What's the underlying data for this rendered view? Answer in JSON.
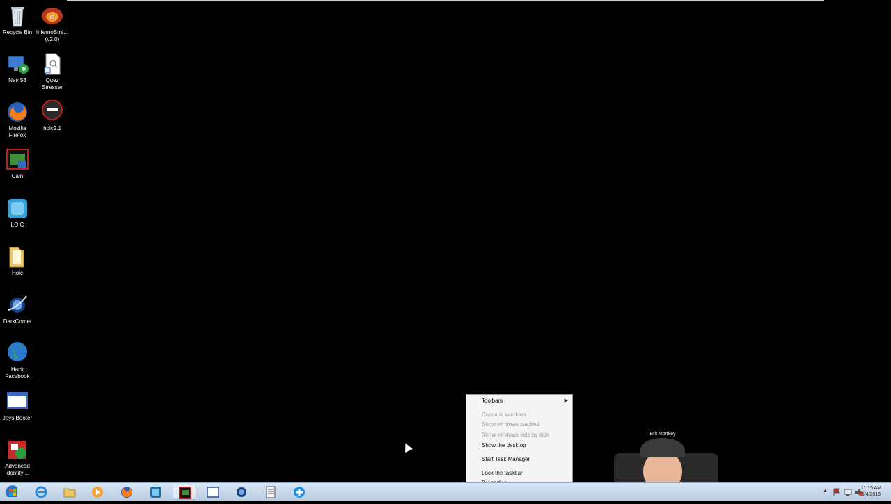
{
  "desktop": {
    "icons": [
      {
        "label": "Recycle Bin",
        "icon": "recycle-bin-icon"
      },
      {
        "label": "InfernoStre... (v2.0)",
        "icon": "inferno-stresser-icon"
      },
      {
        "label": "Net453",
        "icon": "net453-icon"
      },
      {
        "label": "Quez Stresser",
        "icon": "document-icon"
      },
      {
        "label": "Mozilla Firefox",
        "icon": "firefox-icon"
      },
      {
        "label": "hoic2.1",
        "icon": "hoic-icon"
      },
      {
        "label": "Cain",
        "icon": "cain-icon"
      },
      {
        "label": "LOIC",
        "icon": "loic-icon"
      },
      {
        "label": "Hoic",
        "icon": "folder-icon"
      },
      {
        "label": "DarkComet",
        "icon": "darkcomet-icon"
      },
      {
        "label": "Hack Facebook",
        "icon": "globe-icon"
      },
      {
        "label": "Jays Booter",
        "icon": "window-icon"
      },
      {
        "label": "Advanced Identity ...",
        "icon": "advanced-identity-icon"
      }
    ]
  },
  "context_menu": {
    "items": [
      {
        "label": "Toolbars",
        "enabled": true,
        "submenu": true
      },
      {
        "label": "Cascade windows",
        "enabled": false
      },
      {
        "label": "Show windows stacked",
        "enabled": false
      },
      {
        "label": "Show windows side by side",
        "enabled": false
      },
      {
        "label": "Show the desktop",
        "enabled": true
      },
      {
        "label": "Start Task Manager",
        "enabled": true
      },
      {
        "label": "Lock the taskbar",
        "enabled": true
      },
      {
        "label": "Properties",
        "enabled": true
      }
    ]
  },
  "taskbar": {
    "buttons": [
      {
        "name": "start-button",
        "icon": "windows-logo-icon"
      },
      {
        "name": "internet-explorer",
        "icon": "ie-icon"
      },
      {
        "name": "file-explorer",
        "icon": "folder-icon"
      },
      {
        "name": "media-player",
        "icon": "play-icon"
      },
      {
        "name": "firefox",
        "icon": "firefox-icon"
      },
      {
        "name": "loic",
        "icon": "loic-icon"
      },
      {
        "name": "cain",
        "icon": "cain-icon"
      },
      {
        "name": "window",
        "icon": "window-icon"
      },
      {
        "name": "darkcomet",
        "icon": "darkcomet-icon"
      },
      {
        "name": "notepad",
        "icon": "notepad-icon"
      },
      {
        "name": "plus-app",
        "icon": "plus-icon"
      }
    ],
    "clock": {
      "time": "11:15 AM",
      "date": "9/4/2016"
    }
  },
  "webcam": {
    "cap_text": "Brit Monkey"
  }
}
